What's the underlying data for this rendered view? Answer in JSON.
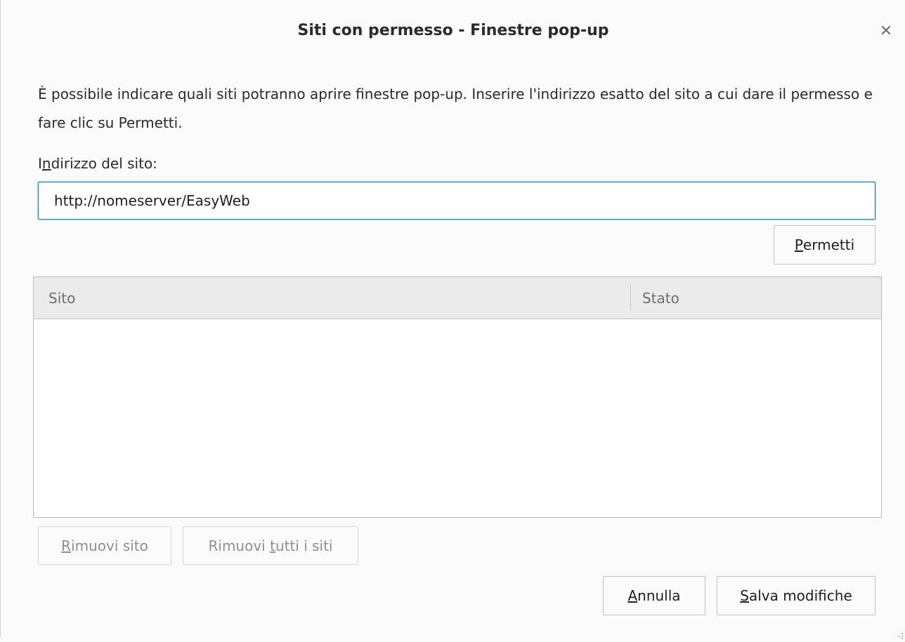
{
  "dialog": {
    "title": "Siti con permesso - Finestre pop-up",
    "description": "È possibile indicare quali siti potranno aprire finestre pop-up. Inserire l'indirizzo esatto del sito a cui dare il permesso e fare clic su Permetti."
  },
  "form": {
    "address_label_prefix": "I",
    "address_label_accel": "n",
    "address_label_rest": "dirizzo del sito:",
    "address_value": "http://nomeserver/EasyWeb"
  },
  "buttons": {
    "permetti_accel": "P",
    "permetti_rest": "ermetti",
    "rimuovi_accel": "R",
    "rimuovi_rest": "imuovi sito",
    "rimuovi_tutti_pre": "Rimuovi ",
    "rimuovi_tutti_accel": "t",
    "rimuovi_tutti_rest": "utti i siti",
    "annulla_accel": "A",
    "annulla_rest": "nnulla",
    "salva_accel": "S",
    "salva_rest": "alva modifiche"
  },
  "table": {
    "columns": [
      "Sito",
      "Stato"
    ],
    "rows": []
  },
  "icons": {
    "close": "close-icon",
    "resize": "resize-grip-icon"
  },
  "colors": {
    "accent": "#0a84d6",
    "header_bg": "#ebebeb",
    "disabled_text": "#8f8f8f"
  }
}
